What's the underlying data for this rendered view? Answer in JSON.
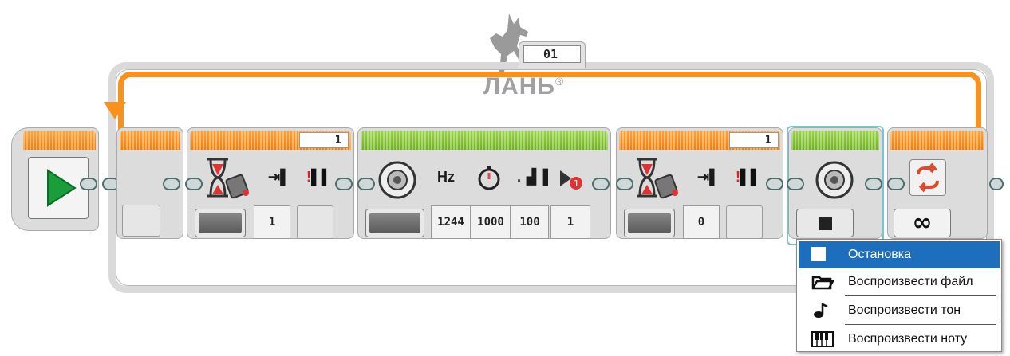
{
  "loop": {
    "name": "01",
    "mode_value": "∞"
  },
  "watermark": {
    "text": "ЛАНЬ",
    "registered": "®"
  },
  "wait_block_1": {
    "header_value": "1",
    "threshold": "1"
  },
  "sound_tone_block": {
    "hz_label": "Hz",
    "frequency": "1244",
    "duration": "1000",
    "volume": "100",
    "play_type": "1"
  },
  "wait_block_2": {
    "header_value": "1",
    "threshold": "0"
  },
  "sound_mode_menu": {
    "items": [
      {
        "label": "Остановка",
        "icon": "stop-square-icon",
        "selected": true
      },
      {
        "label": "Воспроизвести файл",
        "icon": "folder-icon",
        "selected": false
      },
      {
        "label": "Воспроизвести тон",
        "icon": "music-note-icon",
        "selected": false
      },
      {
        "label": "Воспроизвести ноту",
        "icon": "piano-keys-icon",
        "selected": false
      }
    ]
  },
  "colors": {
    "flow_orange": "#f7921e",
    "action_green": "#7cc02a",
    "selection_blue": "#1d6fbe",
    "start_arrow_green": "#1a9e3c",
    "loop_arrow_red": "#e04a2a"
  }
}
